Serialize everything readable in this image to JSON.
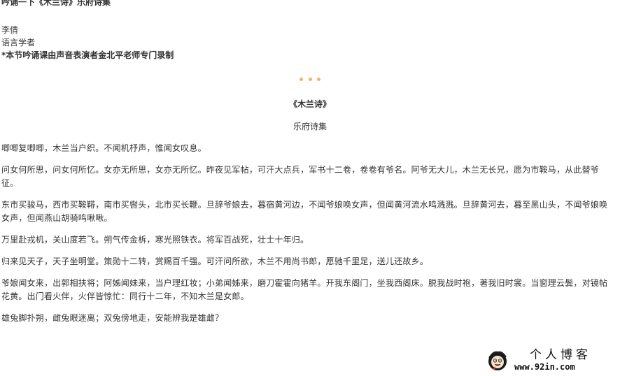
{
  "article": {
    "header_title": "吟诵一下《木兰诗》乐府诗集",
    "author_name": "李倩",
    "author_role": "语言学者",
    "recording_note": "*本节吟诵课由声音表演者金北平老师专门录制"
  },
  "poem": {
    "title": "《木兰诗》",
    "source": "乐府诗集",
    "stanzas": [
      "唧唧复唧唧，木兰当户织。不闻机杼声，惟闻女叹息。",
      "问女何所思，问女何所忆。女亦无所思，女亦无所忆。昨夜见军帖，可汗大点兵，军书十二卷，卷卷有爷名。阿爷无大儿，木兰无长兄，愿为市鞍马，从此替爷征。",
      "东市买骏马，西市买鞍鞯，南市买辔头，北市买长鞭。旦辞爷娘去，暮宿黄河边，不闻爷娘唤女声，但闻黄河流水鸣溅溅。旦辞黄河去，暮至黑山头，不闻爷娘唤女声，但闻燕山胡骑鸣啾啾。",
      "万里赴戎机，关山度若飞。朔气传金柝，寒光照铁衣。将军百战死，壮士十年归。",
      "归来见天子，天子坐明堂。策勋十二转，赏赐百千强。可汗问所欲，木兰不用尚书郎，愿驰千里足，送儿还故乡。",
      "爷娘闻女来，出郭相扶将；阿姊闻妹来，当户理红妆；小弟闻姊来，磨刀霍霍向猪羊。开我东阁门，坐我西阁床。脱我战时袍，著我旧时裳。当窗理云鬓，对镜帖花黄。出门看火伴，火伴皆惊忙：同行十二年，不知木兰是女郎。",
      "雄兔脚扑朔，雌兔眼迷离；双兔傍地走，安能辨我是雄雌？"
    ]
  },
  "watermark": {
    "site_name": "个人博客",
    "url": "www.92in.com"
  },
  "colors": {
    "text": "#333333",
    "divider_dots": "#f2b26b",
    "watermark": "#111111"
  }
}
